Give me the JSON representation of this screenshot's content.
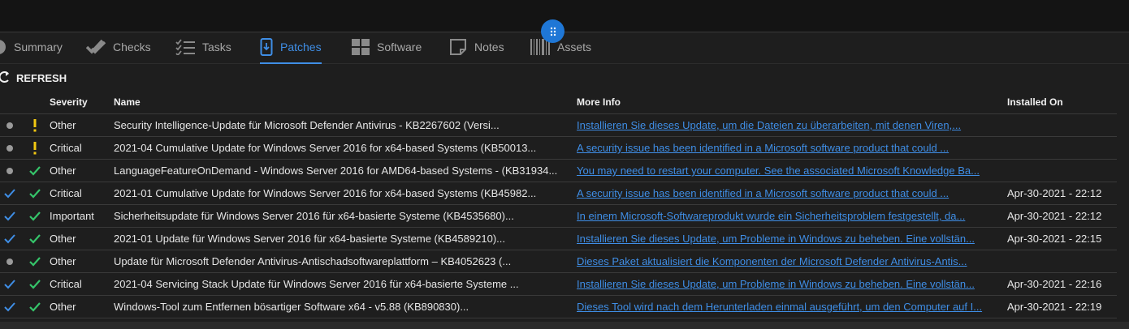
{
  "tabs": [
    {
      "label": "Summary",
      "icon": "circle-icon",
      "active": false
    },
    {
      "label": "Checks",
      "icon": "double-check-icon",
      "active": false
    },
    {
      "label": "Tasks",
      "icon": "checklist-icon",
      "active": false
    },
    {
      "label": "Patches",
      "icon": "phone-download-icon",
      "active": true
    },
    {
      "label": "Software",
      "icon": "windows-icon",
      "active": false
    },
    {
      "label": "Notes",
      "icon": "note-icon",
      "active": false
    },
    {
      "label": "Assets",
      "icon": "barcode-icon",
      "active": false
    }
  ],
  "toolbar": {
    "refresh_label": "REFRESH"
  },
  "table": {
    "headers": {
      "severity": "Severity",
      "name": "Name",
      "more_info": "More Info",
      "installed_on": "Installed On"
    },
    "rows": [
      {
        "status": "dot",
        "approval": "warning",
        "severity": "Other",
        "name": "Security Intelligence-Update für Microsoft Defender Antivirus - KB2267602 (Versi...",
        "more_info": "Installieren Sie dieses Update, um die Dateien zu überarbeiten, mit denen Viren,...",
        "installed_on": ""
      },
      {
        "status": "dot",
        "approval": "warning",
        "severity": "Critical",
        "name": "2021-04 Cumulative Update for Windows Server 2016 for x64-based Systems (KB50013...",
        "more_info": "A security issue has been identified in a Microsoft software product that could ...",
        "installed_on": ""
      },
      {
        "status": "dot",
        "approval": "approved",
        "severity": "Other",
        "name": "LanguageFeatureOnDemand - Windows Server 2016 for AMD64-based Systems - (KB31934...",
        "more_info": "You may need to restart your computer. See the associated Microsoft Knowledge Ba...",
        "installed_on": ""
      },
      {
        "status": "installed",
        "approval": "approved",
        "severity": "Critical",
        "name": "2021-01 Cumulative Update for Windows Server 2016 for x64-based Systems (KB45982...",
        "more_info": "A security issue has been identified in a Microsoft software product that could ...",
        "installed_on": "Apr-30-2021 - 22:12"
      },
      {
        "status": "installed",
        "approval": "approved",
        "severity": "Important",
        "name": "Sicherheitsupdate für Windows Server 2016 für x64-basierte Systeme (KB4535680)...",
        "more_info": "In einem Microsoft-Softwareprodukt wurde ein Sicherheitsproblem festgestellt, da...",
        "installed_on": "Apr-30-2021 - 22:12"
      },
      {
        "status": "installed",
        "approval": "approved",
        "severity": "Other",
        "name": "2021-01 Update für Windows Server 2016 für x64-basierte Systeme (KB4589210)...",
        "more_info": "Installieren Sie dieses Update, um Probleme in Windows zu beheben. Eine vollstän...",
        "installed_on": "Apr-30-2021 - 22:15"
      },
      {
        "status": "dot",
        "approval": "approved",
        "severity": "Other",
        "name": "Update für Microsoft Defender Antivirus-Antischadsoftwareplattform – KB4052623 (...",
        "more_info": "Dieses Paket aktualisiert die Komponenten der Microsoft Defender Antivirus-Antis...",
        "installed_on": ""
      },
      {
        "status": "installed",
        "approval": "approved",
        "severity": "Critical",
        "name": "2021-04 Servicing Stack Update für Windows Server 2016 für x64-basierte Systeme ...",
        "more_info": "Installieren Sie dieses Update, um Probleme in Windows zu beheben. Eine vollstän...",
        "installed_on": "Apr-30-2021 - 22:16"
      },
      {
        "status": "installed",
        "approval": "approved",
        "severity": "Other",
        "name": "Windows-Tool zum Entfernen bösartiger Software x64 - v5.88 (KB890830)...",
        "more_info": "Dieses Tool wird nach dem Herunterladen einmal ausgeführt, um den Computer auf I...",
        "installed_on": "Apr-30-2021 - 22:19"
      }
    ]
  },
  "colors": {
    "accent": "#3f8ee6",
    "warning": "#f2c811",
    "approved": "#35c46a",
    "dot": "#9a9a9a",
    "background": "#1e1e1e"
  }
}
